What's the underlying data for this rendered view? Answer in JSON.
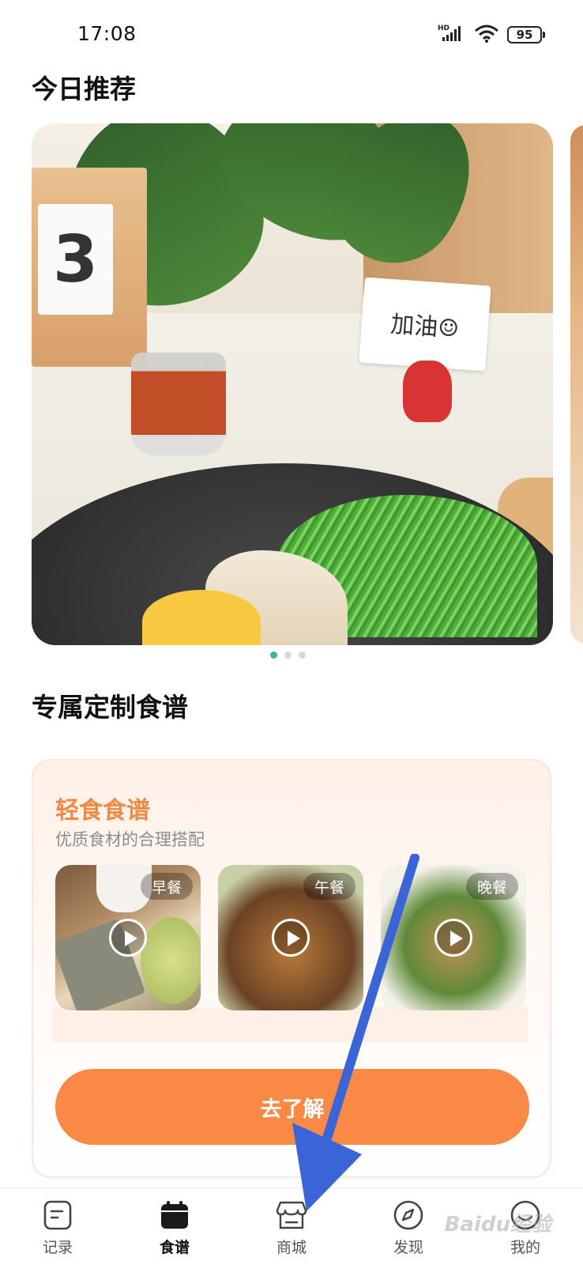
{
  "status_bar": {
    "time": "17:08",
    "network_badge": "HD",
    "battery": "95",
    "icons": [
      "signal-icon",
      "wifi-icon",
      "battery-icon"
    ]
  },
  "today": {
    "title": "今日推荐",
    "hero_sign_text": "加油☺",
    "calendar_number": "3",
    "carousel_pages": 3,
    "carousel_active_index": 0
  },
  "custom": {
    "title": "专属定制食谱",
    "card": {
      "title": "轻食食谱",
      "subtitle": "优质食材的合理搭配",
      "meals": [
        {
          "label": "早餐"
        },
        {
          "label": "午餐"
        },
        {
          "label": "晚餐"
        }
      ],
      "cta": "去了解"
    }
  },
  "bottom_nav": {
    "items": [
      {
        "label": "记录",
        "icon": "notebook-icon",
        "active": false
      },
      {
        "label": "食谱",
        "icon": "calendar-icon",
        "active": true
      },
      {
        "label": "商城",
        "icon": "store-icon",
        "active": false
      },
      {
        "label": "发现",
        "icon": "compass-icon",
        "active": false
      },
      {
        "label": "我的",
        "icon": "profile-icon",
        "active": false
      }
    ]
  },
  "overlay": {
    "watermark": "Baidu经验",
    "arrow_color": "#3a64d8"
  },
  "colors": {
    "accent": "#fb8946",
    "recipe_title": "#f28a47",
    "dot_active": "#3fb39c"
  }
}
